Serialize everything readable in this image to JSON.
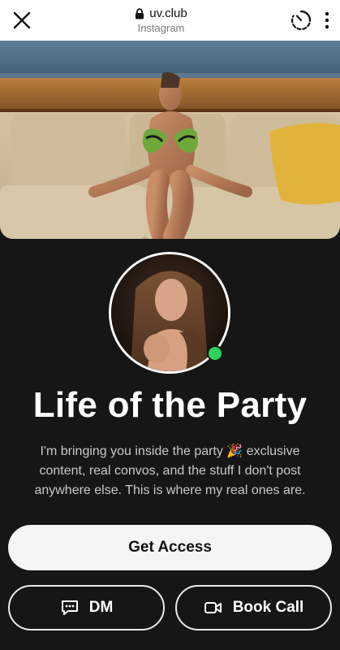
{
  "browser": {
    "domain": "uv.club",
    "subtitle": "Instagram",
    "icons": {
      "close": "close-icon",
      "lock": "lock-icon",
      "timer": "timer-icon",
      "more": "more-vertical-icon"
    }
  },
  "profile": {
    "title": "Life of the Party",
    "bio": "I'm bringing you inside the party 🎉 exclusive content, real convos, and the stuff I don't post anywhere else. This is where my real ones are.",
    "status_color": "#2ed15a"
  },
  "actions": {
    "primary": "Get Access",
    "dm": "DM",
    "book_call": "Book Call"
  }
}
